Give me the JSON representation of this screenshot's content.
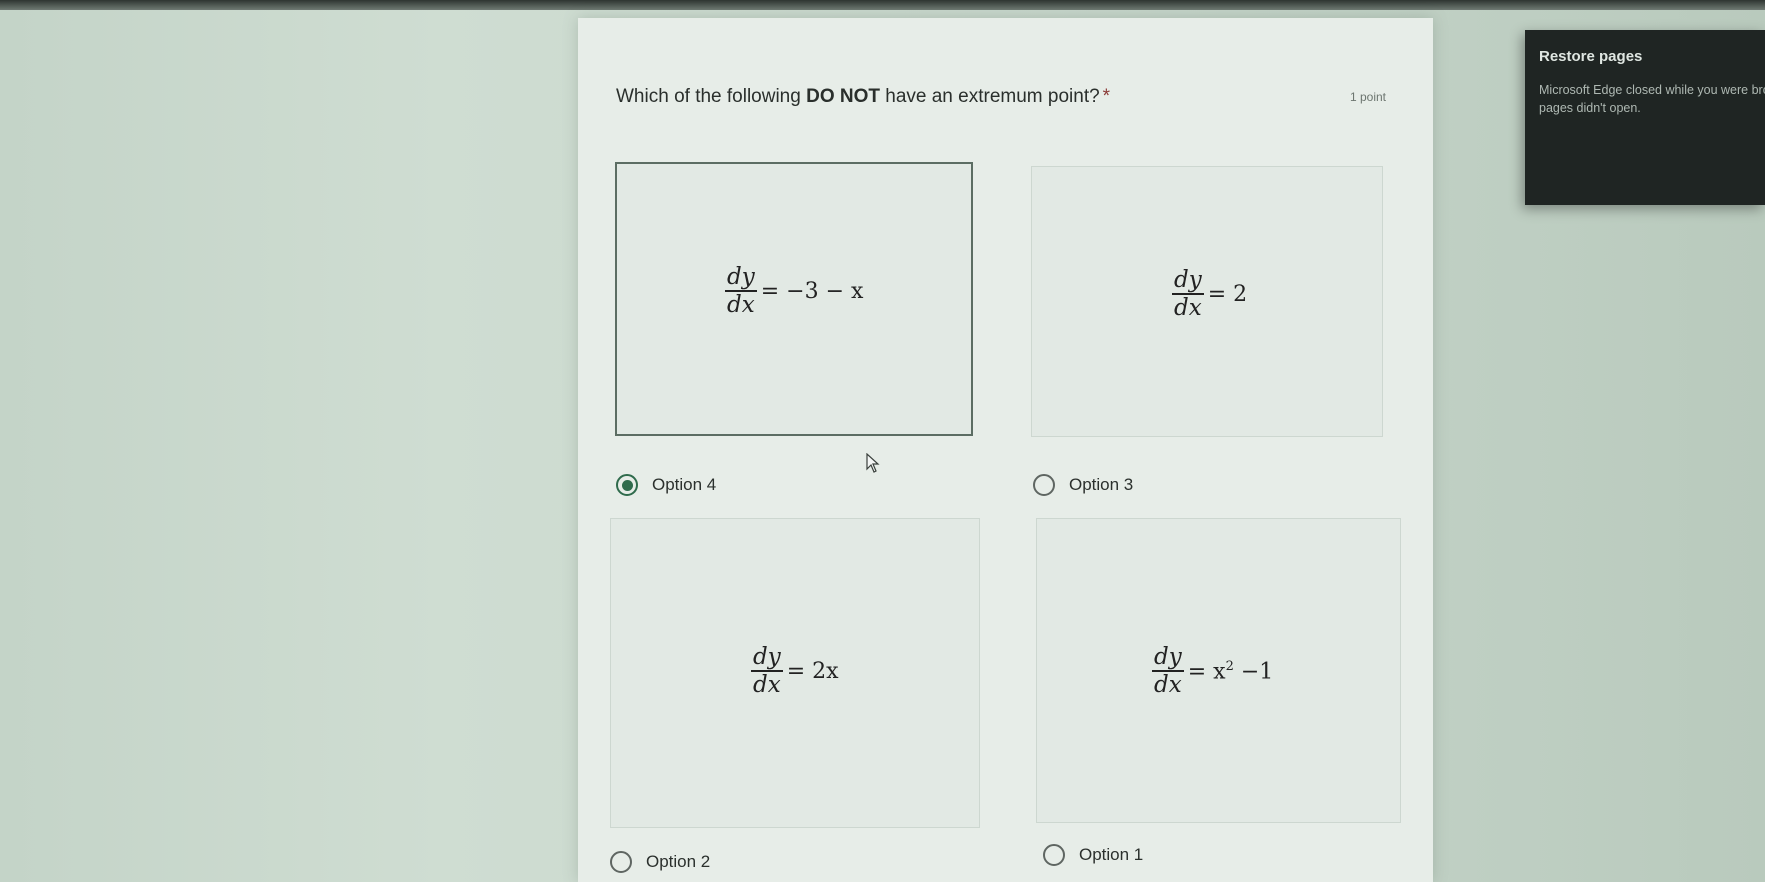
{
  "question": {
    "prefix": "Which of the following ",
    "emphasis": "DO NOT",
    "suffix": " have an extremum point?",
    "required_marker": "*",
    "points": "1 point"
  },
  "options": [
    {
      "label": "Option 4",
      "selected": true,
      "equation": {
        "numerator": "dy",
        "denominator": "dx",
        "rhs": "= −3 − x"
      }
    },
    {
      "label": "Option 3",
      "selected": false,
      "equation": {
        "numerator": "dy",
        "denominator": "dx",
        "rhs": "= 2"
      }
    },
    {
      "label": "Option 2",
      "selected": false,
      "equation": {
        "numerator": "dy",
        "denominator": "dx",
        "rhs": "= 2x"
      }
    },
    {
      "label": "Option 1",
      "selected": false,
      "equation": {
        "numerator": "dy",
        "denominator": "dx",
        "rhs_base": "= x",
        "rhs_exp": "2",
        "rhs_tail": " −1"
      }
    }
  ],
  "toast": {
    "title": "Restore pages",
    "message": "Microsoft Edge closed while you were browsing. Some pages didn't open."
  },
  "icons": {
    "cursor": "mouse-pointer-icon",
    "radio_selected": "radio-selected-icon",
    "radio_unselected": "radio-unselected-icon"
  },
  "colors": {
    "accent": "#2f6b4c",
    "card_background": "#e7ede8",
    "toast_background": "#1f2523"
  }
}
